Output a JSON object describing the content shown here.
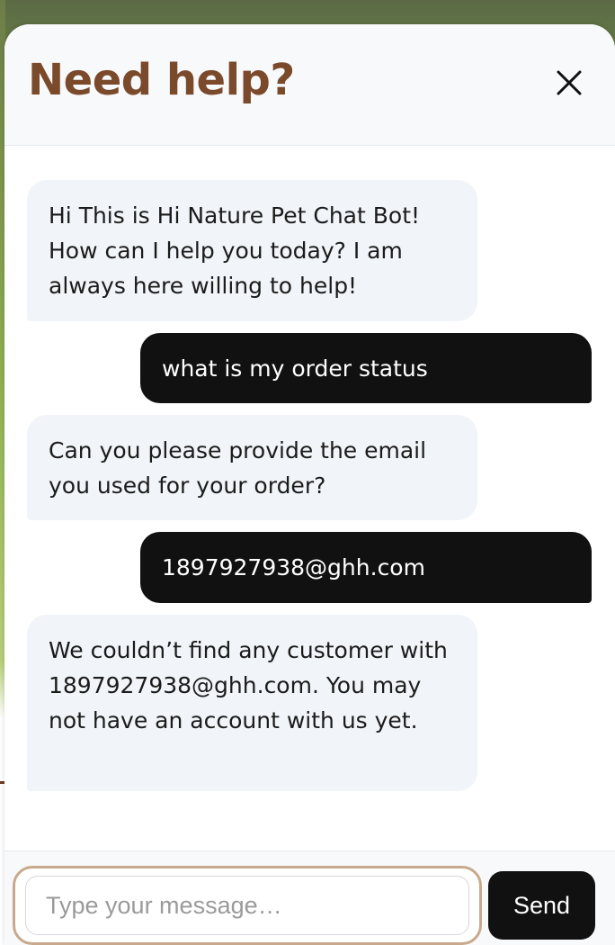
{
  "header": {
    "title": "Need help?",
    "close_icon": "close-icon"
  },
  "messages": [
    {
      "sender": "bot",
      "text": "Hi This is Hi Nature Pet Chat Bot! How can I help you today? I am always here willing to help!"
    },
    {
      "sender": "user",
      "text": "what is my order status"
    },
    {
      "sender": "bot",
      "text": "Can you please provide the email you used for your order?"
    },
    {
      "sender": "user",
      "text": "1897927938@ghh.com"
    },
    {
      "sender": "bot",
      "text": "We couldn’t find any customer with 1897927938@ghh.com. You may not have an account with us yet."
    }
  ],
  "composer": {
    "placeholder": "Type your message…",
    "value": "",
    "send_label": "Send"
  },
  "colors": {
    "title": "#7a4a2b",
    "user_bubble": "#111111",
    "bot_bubble": "#f1f4f8",
    "input_focus_ring": "#c9a98c",
    "send_button": "#111111"
  }
}
